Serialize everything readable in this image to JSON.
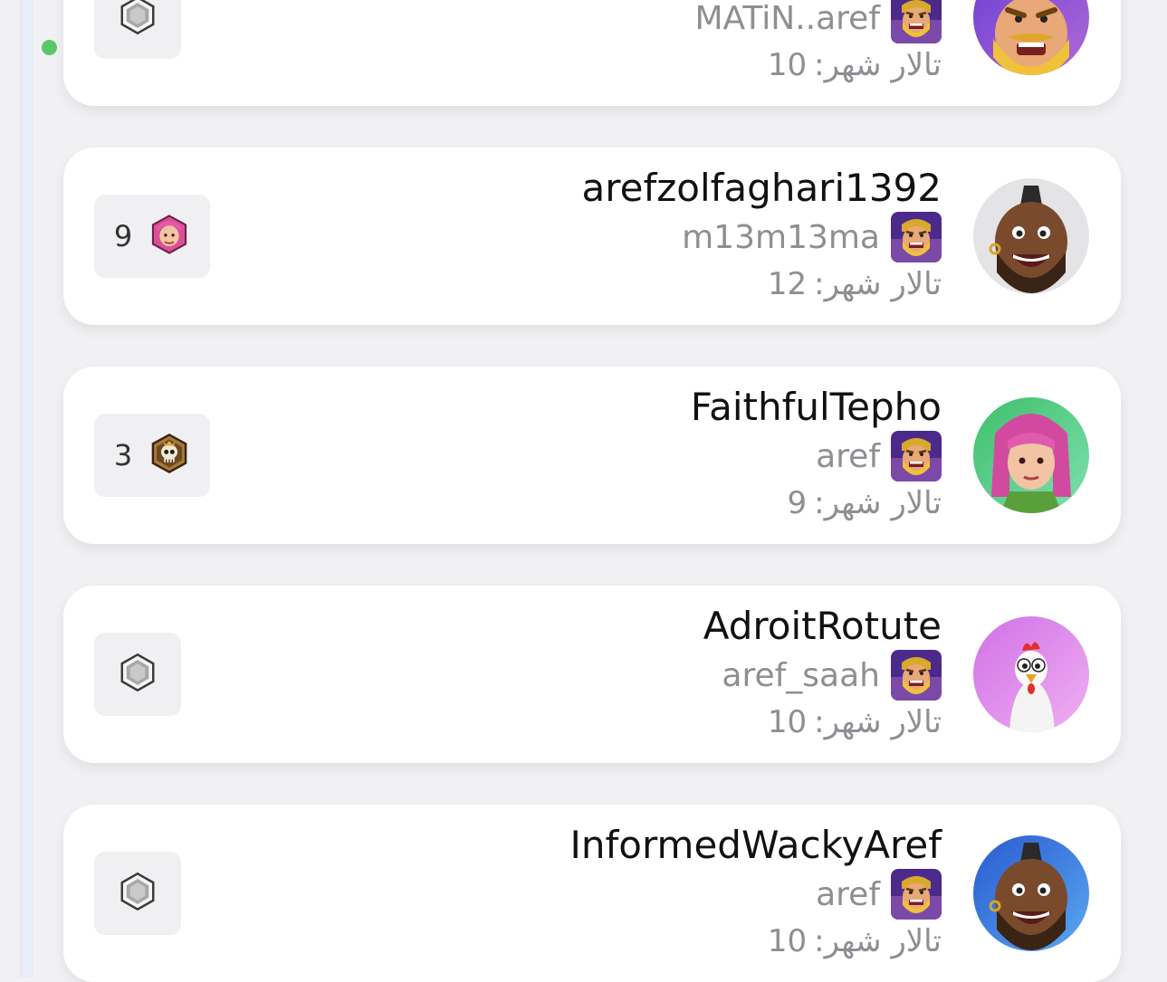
{
  "status": {
    "online_color": "#5ac86a"
  },
  "players": [
    {
      "name": "",
      "clan": "MATiN..aref",
      "townhall_label": "تالار شهر:",
      "townhall_level": "10",
      "league_count": "",
      "avatar": "barbarian-avatar",
      "league_icon": "unranked-league-icon"
    },
    {
      "name": "arefzolfaghari1392",
      "clan": "m13m13ma",
      "townhall_label": "تالار شهر:",
      "townhall_level": "12",
      "league_count": "9",
      "avatar": "hog-rider-avatar",
      "league_icon": "archer-queen-league-icon"
    },
    {
      "name": "FaithfulTepho",
      "clan": "aref",
      "townhall_label": "تالار شهر:",
      "townhall_level": "9",
      "league_count": "3",
      "avatar": "archer-avatar",
      "league_icon": "skull-league-icon"
    },
    {
      "name": "AdroitRotute",
      "clan": "aref_saah",
      "townhall_label": "تالار شهر:",
      "townhall_level": "10",
      "league_count": "",
      "avatar": "chicken-avatar",
      "league_icon": "unranked-league-icon"
    },
    {
      "name": "InformedWackyAref",
      "clan": "aref",
      "townhall_label": "تالار شهر:",
      "townhall_level": "10",
      "league_count": "",
      "avatar": "hog-rider-avatar",
      "league_icon": "unranked-league-icon"
    }
  ]
}
